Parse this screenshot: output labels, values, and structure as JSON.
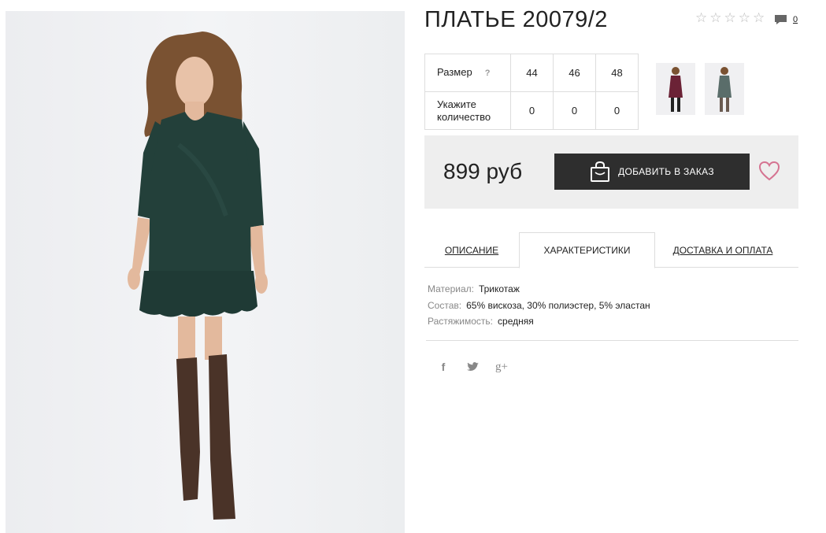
{
  "product": {
    "title": "ПЛАТЬЕ 20079/2",
    "comment_count": "0"
  },
  "sizes": {
    "size_label": "Размер",
    "help_mark": "?",
    "qty_label_line1": "Укажите",
    "qty_label_line2": "количество",
    "values": [
      "44",
      "46",
      "48"
    ],
    "quantities": [
      "0",
      "0",
      "0"
    ]
  },
  "purchase": {
    "price": "899 руб",
    "add_button": "ДОБАВИТЬ В ЗАКАЗ"
  },
  "tabs": [
    "ОПИСАНИЕ",
    "ХАРАКТЕРИСТИКИ",
    "ДОСТАВКА И ОПЛАТА"
  ],
  "characteristics": [
    {
      "key": "Материал:",
      "value": "Трикотаж"
    },
    {
      "key": "Состав:",
      "value": "65% вискоза, 30% полиэстер, 5% эластан"
    },
    {
      "key": "Растяжимость:",
      "value": "средняя"
    }
  ],
  "social": [
    "f",
    "t",
    "g+"
  ],
  "colors": {
    "dress_green": "#23403a",
    "button_bg": "#2e2e2e",
    "heart": "#d57391",
    "price_box": "#eeeeee"
  }
}
